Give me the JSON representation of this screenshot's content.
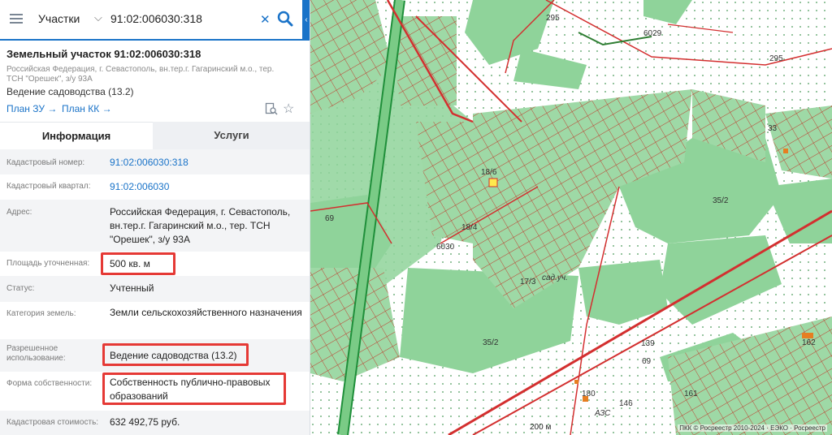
{
  "search": {
    "category": "Участки",
    "query": "91:02:006030:318"
  },
  "card": {
    "title": "Земельный участок 91:02:006030:318",
    "address_short": "Российская Федерация, г. Севастополь, вн.тер.г. Гагаринский м.о., тер. ТСН \"Орешек\", з/у 93А",
    "use_short": "Ведение садоводства (13.2)",
    "link_zu": "План ЗУ →",
    "link_kk": "План КК →"
  },
  "tabs": {
    "info": "Информация",
    "services": "Услуги"
  },
  "fields": {
    "cadnum": {
      "label": "Кадастровый номер:",
      "value": "91:02:006030:318"
    },
    "quarter": {
      "label": "Кадастровый квартал:",
      "value": "91:02:006030"
    },
    "address": {
      "label": "Адрес:",
      "value": "Российская Федерация, г. Севастополь, вн.тер.г. Гагаринский м.о., тер. ТСН \"Орешек\", з/у 93А"
    },
    "area": {
      "label": "Площадь уточненная:",
      "value": "500 кв. м"
    },
    "status": {
      "label": "Статус:",
      "value": "Учтенный"
    },
    "category": {
      "label": "Категория земель:",
      "value": "Земли сельскохозяйственного назначения"
    },
    "permitted": {
      "label": "Разрешенное использование:",
      "value": "Ведение садоводства (13.2)"
    },
    "ownership": {
      "label": "Форма собственности:",
      "value": "Собственность публично-правовых образований"
    },
    "cost": {
      "label": "Кадастровая стоимость:",
      "value": "632 492,75 руб."
    }
  },
  "map": {
    "labels": [
      "295",
      "6029",
      "295",
      "35/2",
      "69",
      "6030",
      "сад.уч.",
      "35/2",
      "139",
      "69",
      "180",
      "146",
      "АЗС",
      "17/3",
      "18/6",
      "18/4",
      "162",
      "161",
      "33"
    ],
    "scale": "200 м",
    "attribution": "ПКК © Росреестр 2010-2024 · ЕЭКО · Росреестр"
  },
  "colors": {
    "accent": "#1a73c8",
    "highlight": "#e53935",
    "map_green": "#8fd39a",
    "map_red": "#d32f2f"
  }
}
